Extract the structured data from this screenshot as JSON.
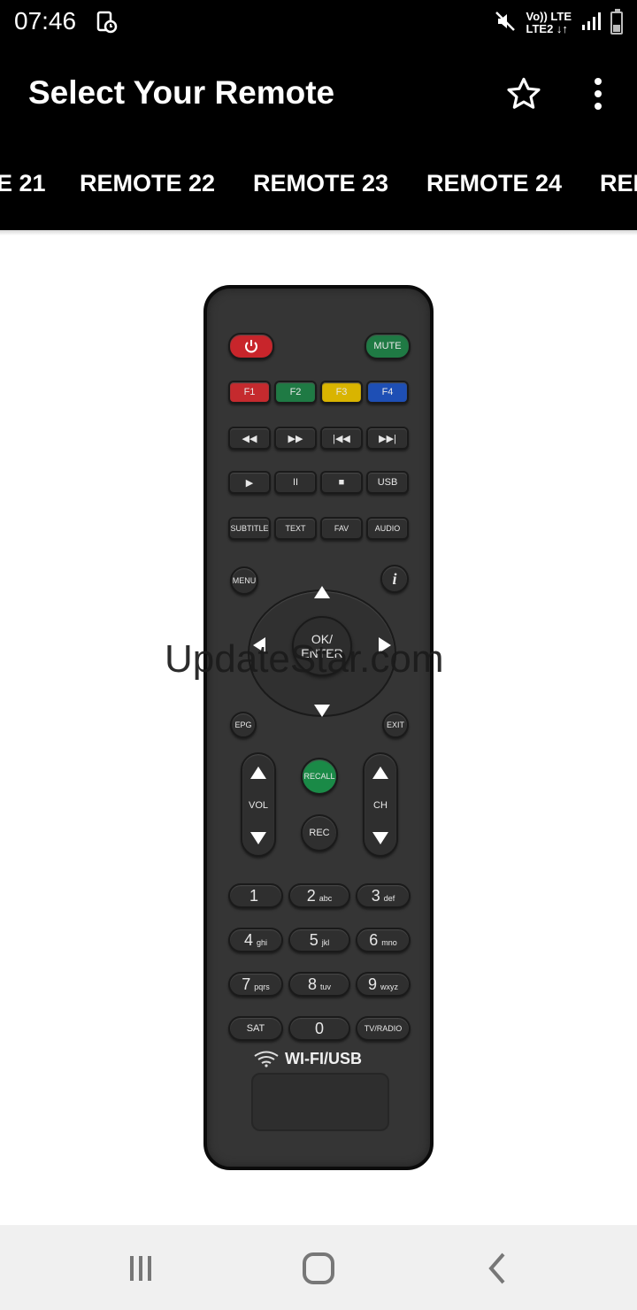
{
  "status_bar": {
    "time": "07:46",
    "network_top": "Vo)) LTE",
    "network_bottom": "LTE2 ↓↑",
    "battery_level": 0.35,
    "icons": [
      "mute-icon",
      "signal-icon",
      "battery-icon",
      "app-notification-icon"
    ]
  },
  "app_bar": {
    "title": "Select Your Remote",
    "favorite_icon": "star-outline-icon",
    "menu_icon": "more-vert-icon"
  },
  "tabs": [
    {
      "label": "E 21"
    },
    {
      "label": "REMOTE 22"
    },
    {
      "label": "REMOTE 23"
    },
    {
      "label": "REMOTE 24"
    },
    {
      "label": "REM"
    }
  ],
  "remote": {
    "mute": "MUTE",
    "f_keys": [
      "F1",
      "F2",
      "F3",
      "F4"
    ],
    "transport_row1": [
      "◀◀",
      "▶▶",
      "|◀◀",
      "▶▶|"
    ],
    "transport_row2": [
      "▶",
      "II",
      "■",
      "USB"
    ],
    "function_row": [
      "SUBTITLE",
      "TEXT",
      "FAV",
      "AUDIO"
    ],
    "menu": "MENU",
    "info": "i",
    "ok": "OK/ ENTER",
    "epg": "EPG",
    "exit": "EXIT",
    "vol": "VOL",
    "ch": "CH",
    "recall": "RECALL",
    "rec": "REC",
    "numbers": [
      {
        "n": "1",
        "s": ""
      },
      {
        "n": "2",
        "s": "abc"
      },
      {
        "n": "3",
        "s": "def"
      },
      {
        "n": "4",
        "s": "ghi"
      },
      {
        "n": "5",
        "s": "jkl"
      },
      {
        "n": "6",
        "s": "mno"
      },
      {
        "n": "7",
        "s": "pqrs"
      },
      {
        "n": "8",
        "s": "tuv"
      },
      {
        "n": "9",
        "s": "wxyz"
      }
    ],
    "sat": "SAT",
    "zero": "0",
    "tv_radio": "TV/RADIO",
    "wifi_usb": "WI-FI/USB",
    "colors": {
      "body": "#353535",
      "power": "#c8252b",
      "green": "#1f7a44",
      "yellow": "#d9b400",
      "blue": "#1e4fb5"
    }
  },
  "watermark": "UpdateStar.com",
  "nav_bar": {
    "icons": [
      "recent-apps-icon",
      "home-icon",
      "back-icon"
    ]
  }
}
